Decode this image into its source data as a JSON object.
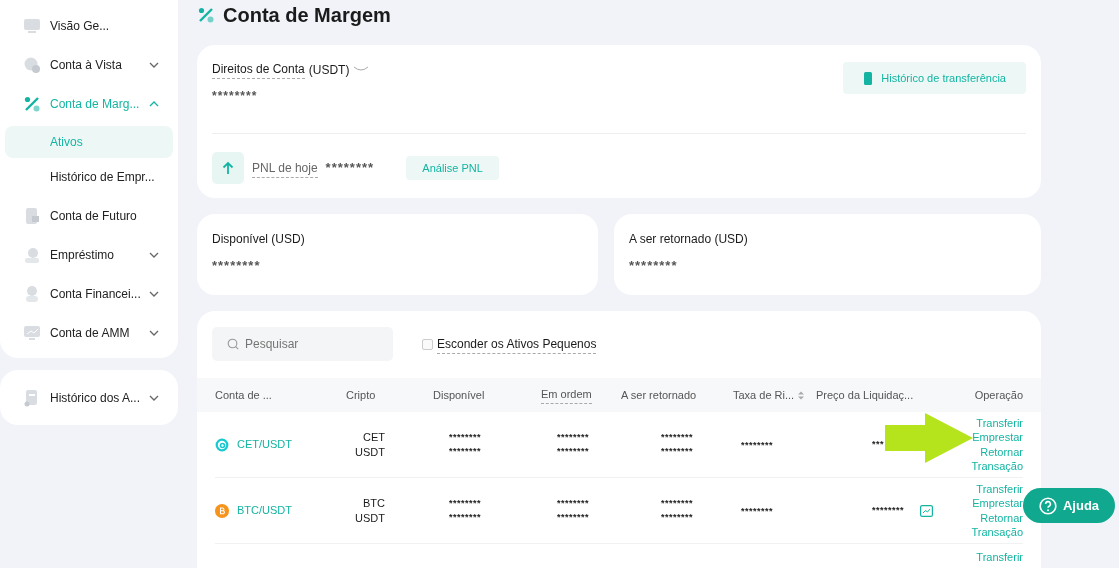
{
  "sidebar": {
    "groups": [
      {
        "items": [
          {
            "kind": "link",
            "label": "Visão Ge...",
            "selected": false
          },
          {
            "kind": "menu",
            "label": "Conta à Vista",
            "selected": false,
            "expanded": false
          },
          {
            "kind": "menu",
            "label": "Conta de Marg...",
            "selected": true,
            "expanded": true,
            "children": [
              {
                "label": "Ativos",
                "selected": true
              },
              {
                "label": "Histórico de Empr...",
                "selected": false
              }
            ]
          },
          {
            "kind": "link",
            "label": "Conta de Futuro",
            "selected": false
          },
          {
            "kind": "menu",
            "label": "Empréstimo",
            "selected": false,
            "expanded": false
          },
          {
            "kind": "menu",
            "label": "Conta Financei...",
            "selected": false,
            "expanded": false
          },
          {
            "kind": "menu",
            "label": "Conta de AMM",
            "selected": false,
            "expanded": false
          }
        ]
      },
      {
        "items": [
          {
            "kind": "menu",
            "label": "Histórico dos A...",
            "selected": false,
            "expanded": false
          }
        ]
      }
    ]
  },
  "page_title": "Conta de Margem",
  "equity": {
    "label": "Direitos de Conta",
    "unit": "(USDT)",
    "value": "********",
    "history_button": "Histórico de transferência",
    "pnl_label": "PNL de hoje",
    "pnl_value": "********",
    "pnl_button": "Análise PNL"
  },
  "balances": [
    {
      "label": "Disponível (USD)",
      "value": "********"
    },
    {
      "label": "A ser retornado (USD)",
      "value": "********"
    }
  ],
  "search": {
    "placeholder": "Pesquisar"
  },
  "hide_small": {
    "label": "Esconder os Ativos Pequenos",
    "checked": false
  },
  "table": {
    "columns": [
      {
        "label": "Conta de ...",
        "sortable": false,
        "hint": false
      },
      {
        "label": "Cripto",
        "sortable": false,
        "hint": false
      },
      {
        "label": "Disponível",
        "sortable": false,
        "hint": false
      },
      {
        "label": "Em ordem",
        "sortable": false,
        "hint": true
      },
      {
        "label": "A ser retornado",
        "sortable": false,
        "hint": false
      },
      {
        "label": "Taxa de Ri...",
        "sortable": true,
        "hint": false
      },
      {
        "label": "Preço da Liquidaç...",
        "sortable": false,
        "hint": false
      },
      {
        "label": "Operação",
        "sortable": false,
        "hint": false
      }
    ],
    "rows": [
      {
        "market": "CET/USDT",
        "kind": "cet",
        "crypto": [
          "CET",
          "USDT"
        ],
        "available": [
          "********",
          "********"
        ],
        "in_order": [
          "********",
          "********"
        ],
        "to_return": [
          "********",
          "********"
        ],
        "risk": "********",
        "liquidation": "***",
        "operations": [
          "Transferir",
          "Emprestar",
          "Retornar",
          "Transação"
        ]
      },
      {
        "market": "BTC/USDT",
        "kind": "btc",
        "crypto": [
          "BTC",
          "USDT"
        ],
        "available": [
          "********",
          "********"
        ],
        "in_order": [
          "********",
          "********"
        ],
        "to_return": [
          "********",
          "********"
        ],
        "risk": "********",
        "liquidation": "********",
        "chart": true,
        "operations": [
          "Transferir",
          "Emprestar",
          "Retornar",
          "Transação"
        ]
      },
      {
        "operations": [
          "Transferir"
        ]
      }
    ]
  },
  "pointer_arrow": true,
  "help_button": "Ajuda"
}
